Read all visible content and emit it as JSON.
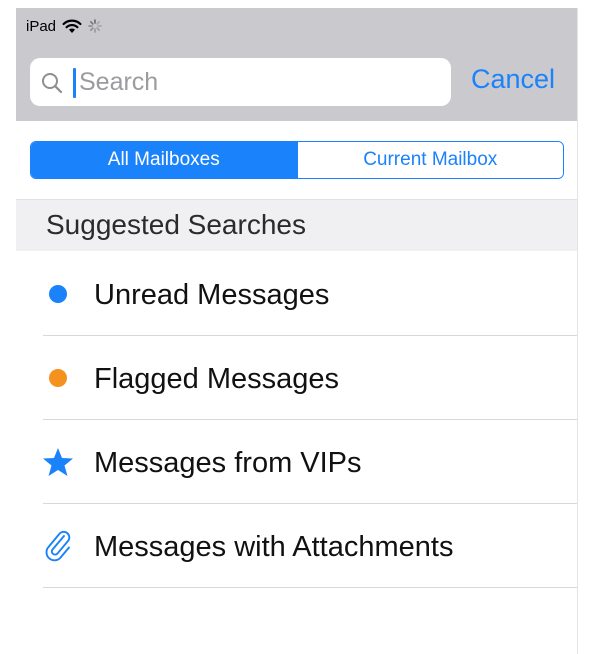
{
  "status_bar": {
    "carrier": "iPad",
    "wifi_icon": "wifi-icon",
    "activity_icon": "activity-spinner-icon"
  },
  "search": {
    "placeholder": "Search",
    "value": "",
    "icon": "search-icon",
    "cancel_label": "Cancel"
  },
  "scope": {
    "options": [
      "All Mailboxes",
      "Current Mailbox"
    ],
    "selected": "All Mailboxes"
  },
  "suggested": {
    "header": "Suggested Searches",
    "items": [
      {
        "label": "Unread Messages",
        "icon": "unread-dot-icon",
        "color": "#1a82fb"
      },
      {
        "label": "Flagged Messages",
        "icon": "flag-dot-icon",
        "color": "#f5911e"
      },
      {
        "label": "Messages from VIPs",
        "icon": "star-icon",
        "color": "#1a82fb"
      },
      {
        "label": "Messages with Attachments",
        "icon": "paperclip-icon",
        "color": "#1a82fb"
      }
    ]
  },
  "colors": {
    "accent": "#1a82fb",
    "header_bg": "#c9c9ce",
    "section_bg": "#f0f0f2"
  }
}
